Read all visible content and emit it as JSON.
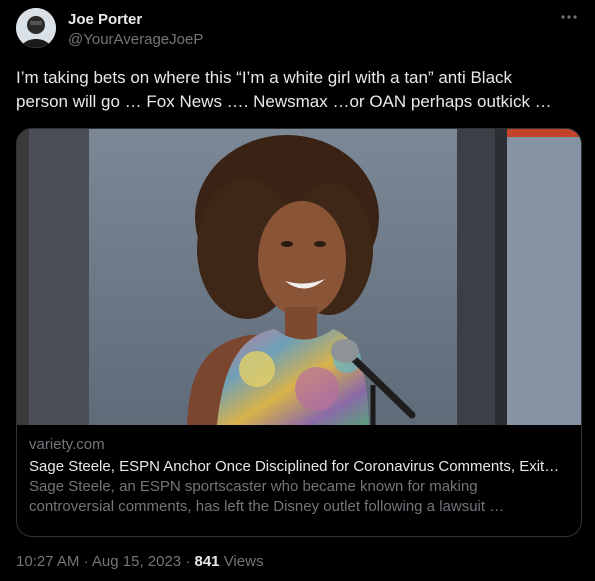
{
  "user": {
    "display_name": "Joe Porter",
    "handle": "@YourAverageJoeP"
  },
  "tweet": {
    "line1": "I’m taking bets on where this “I’m a white girl with a tan” anti Black",
    "line2": "person will go … Fox News …. Newsmax …or OAN perhaps outkick …"
  },
  "card": {
    "domain": "variety.com",
    "title": "Sage Steele, ESPN Anchor Once Disciplined for Coronavirus Comments, Exit…",
    "desc_line1": "Sage Steele, an ESPN sportscaster who became known for making",
    "desc_line2": "controversial comments, has left the Disney outlet following a lawsuit …"
  },
  "footer": {
    "time": "10:27 AM",
    "separator": "·",
    "date": "Aug 15, 2023",
    "views_count": "841",
    "views_label": "Views"
  },
  "icons": {
    "more": "more-horizontal-icon"
  }
}
